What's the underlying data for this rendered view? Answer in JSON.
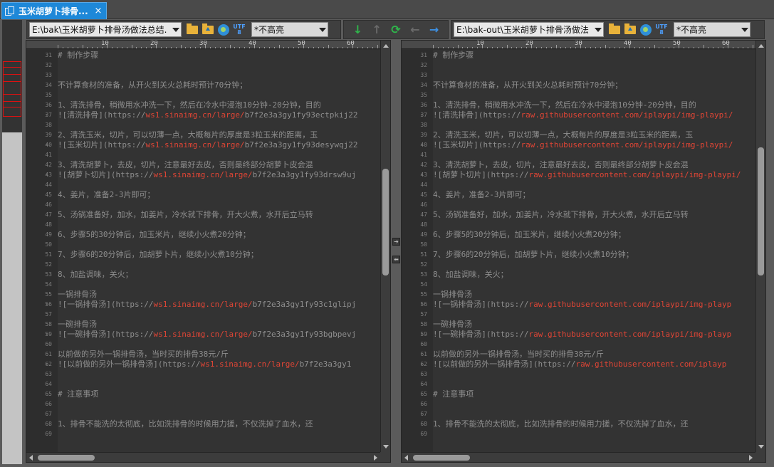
{
  "tab": {
    "title": "玉米胡萝卜排骨...",
    "close": "×",
    "icon": "document-compare-icon"
  },
  "left": {
    "path": "E:\\bak\\玉米胡萝卜排骨汤做法总结.",
    "encoding_icon": "UTF\n8",
    "highlight": "*不高亮"
  },
  "right": {
    "path": "E:\\bak-out\\玉米胡萝卜排骨汤做法",
    "encoding_icon": "UTF\n8",
    "highlight": "*不高亮"
  },
  "center_toolbar": {
    "icons": [
      "next-diff-icon",
      "prev-diff-icon",
      "refresh-icon",
      "copy-to-left-icon",
      "copy-to-right-icon"
    ]
  },
  "ruler": [
    "10",
    "20",
    "30",
    "40",
    "50",
    "60"
  ],
  "line_numbers": [
    "31",
    "32",
    "33",
    "34",
    "35",
    "36",
    "37",
    "38",
    "39",
    "40",
    "41",
    "42",
    "43",
    "44",
    "45",
    "46",
    "47",
    "48",
    "49",
    "50",
    "51",
    "52",
    "53",
    "54",
    "55",
    "56",
    "57",
    "58",
    "59",
    "60",
    "61",
    "62",
    "63",
    "64",
    "65",
    "66",
    "67",
    "68",
    "69"
  ],
  "left_lines": [
    "# 制作步骤",
    "",
    "",
    "不计算食材的准备，从开火到关火总耗时预计70分钟；",
    "",
    "1、清洗排骨，稍微用水冲洗一下，然后在冷水中浸泡10分钟-20分钟，目的",
    "![清洗排骨](https://|ws1.sinaimg.cn/large/|b7f2e3a3gy1fy93ectpkij22",
    "",
    "2、清洗玉米，切片，可以切薄一点，大概每片的厚度是3粒玉米的距离，玉",
    "![玉米切片](https://|ws1.sinaimg.cn/large/|b7f2e3a3gy1fy93desywqj22",
    "",
    "3、清洗胡萝卜，去皮，切片，注意最好去皮，否则最终部分胡萝卜皮会混",
    "![胡萝卜切片](https://|ws1.sinaimg.cn/large/|b7f2e3a3gy1fy93drsw9uj",
    "",
    "4、姜片，准备2-3片即可；",
    "",
    "5、汤锅准备好，加水，加姜片，冷水就下排骨，开大火煮，水开后立马转",
    "",
    "6、步骤5的30分钟后，加玉米片，继续小火煮20分钟；",
    "",
    "7、步骤6的20分钟后，加胡萝卜片，继续小火煮10分钟；",
    "",
    "8、加盐调味，关火；",
    "",
    "一锅排骨汤",
    "![一锅排骨汤](https://|ws1.sinaimg.cn/large/|b7f2e3a3gy1fy93c1glipj",
    "",
    "一碗排骨汤",
    "![一碗排骨汤](https://|ws1.sinaimg.cn/large/|b7f2e3a3gy1fy93bgbpevj",
    "",
    "以前做的另外一锅排骨汤，当时买的排骨38元/斤",
    "![以前做的另外一锅排骨汤](https://|ws1.sinaimg.cn/large/|b7f2e3a3gy1",
    "",
    "",
    "# 注意事项",
    "",
    "",
    "1、排骨不能洗的太彻底，比如洗排骨的时候用力搓，不仅洗掉了血水，还",
    ""
  ],
  "right_lines": [
    "# 制作步骤",
    "",
    "",
    "不计算食材的准备，从开火到关火总耗时预计70分钟；",
    "",
    "1、清洗排骨，稍微用水冲洗一下，然后在冷水中浸泡10分钟-20分钟，目的",
    "![清洗排骨](https://|raw.githubusercontent.com/iplaypi/img-playpi/|",
    "",
    "2、清洗玉米，切片，可以切薄一点，大概每片的厚度是3粒玉米的距离，玉",
    "![玉米切片](https://|raw.githubusercontent.com/iplaypi/img-playpi/|",
    "",
    "3、清洗胡萝卜，去皮，切片，注意最好去皮，否则最终部分胡萝卜皮会混",
    "![胡萝卜切片](https://|raw.githubusercontent.com/iplaypi/img-playpi/|",
    "",
    "4、姜片，准备2-3片即可；",
    "",
    "5、汤锅准备好，加水，加姜片，冷水就下排骨，开大火煮，水开后立马转",
    "",
    "6、步骤5的30分钟后，加玉米片，继续小火煮20分钟；",
    "",
    "7、步骤6的20分钟后，加胡萝卜片，继续小火煮10分钟；",
    "",
    "8、加盐调味，关火；",
    "",
    "一锅排骨汤",
    "![一锅排骨汤](https://|raw.githubusercontent.com/iplaypi/img-playp|",
    "",
    "一碗排骨汤",
    "![一碗排骨汤](https://|raw.githubusercontent.com/iplaypi/img-playp|",
    "",
    "以前做的另外一锅排骨汤，当时买的排骨38元/斤",
    "![以前做的另外一锅排骨汤](https://|raw.githubusercontent.com/iplayp|",
    "",
    "",
    "# 注意事项",
    "",
    "",
    "1、排骨不能洗的太彻底，比如洗排骨的时候用力搓，不仅洗掉了血水，还",
    ""
  ],
  "markers": [
    "37",
    "40",
    "43",
    "56",
    "59",
    "62"
  ],
  "merge_buttons": [
    "➔",
    "⬅"
  ]
}
